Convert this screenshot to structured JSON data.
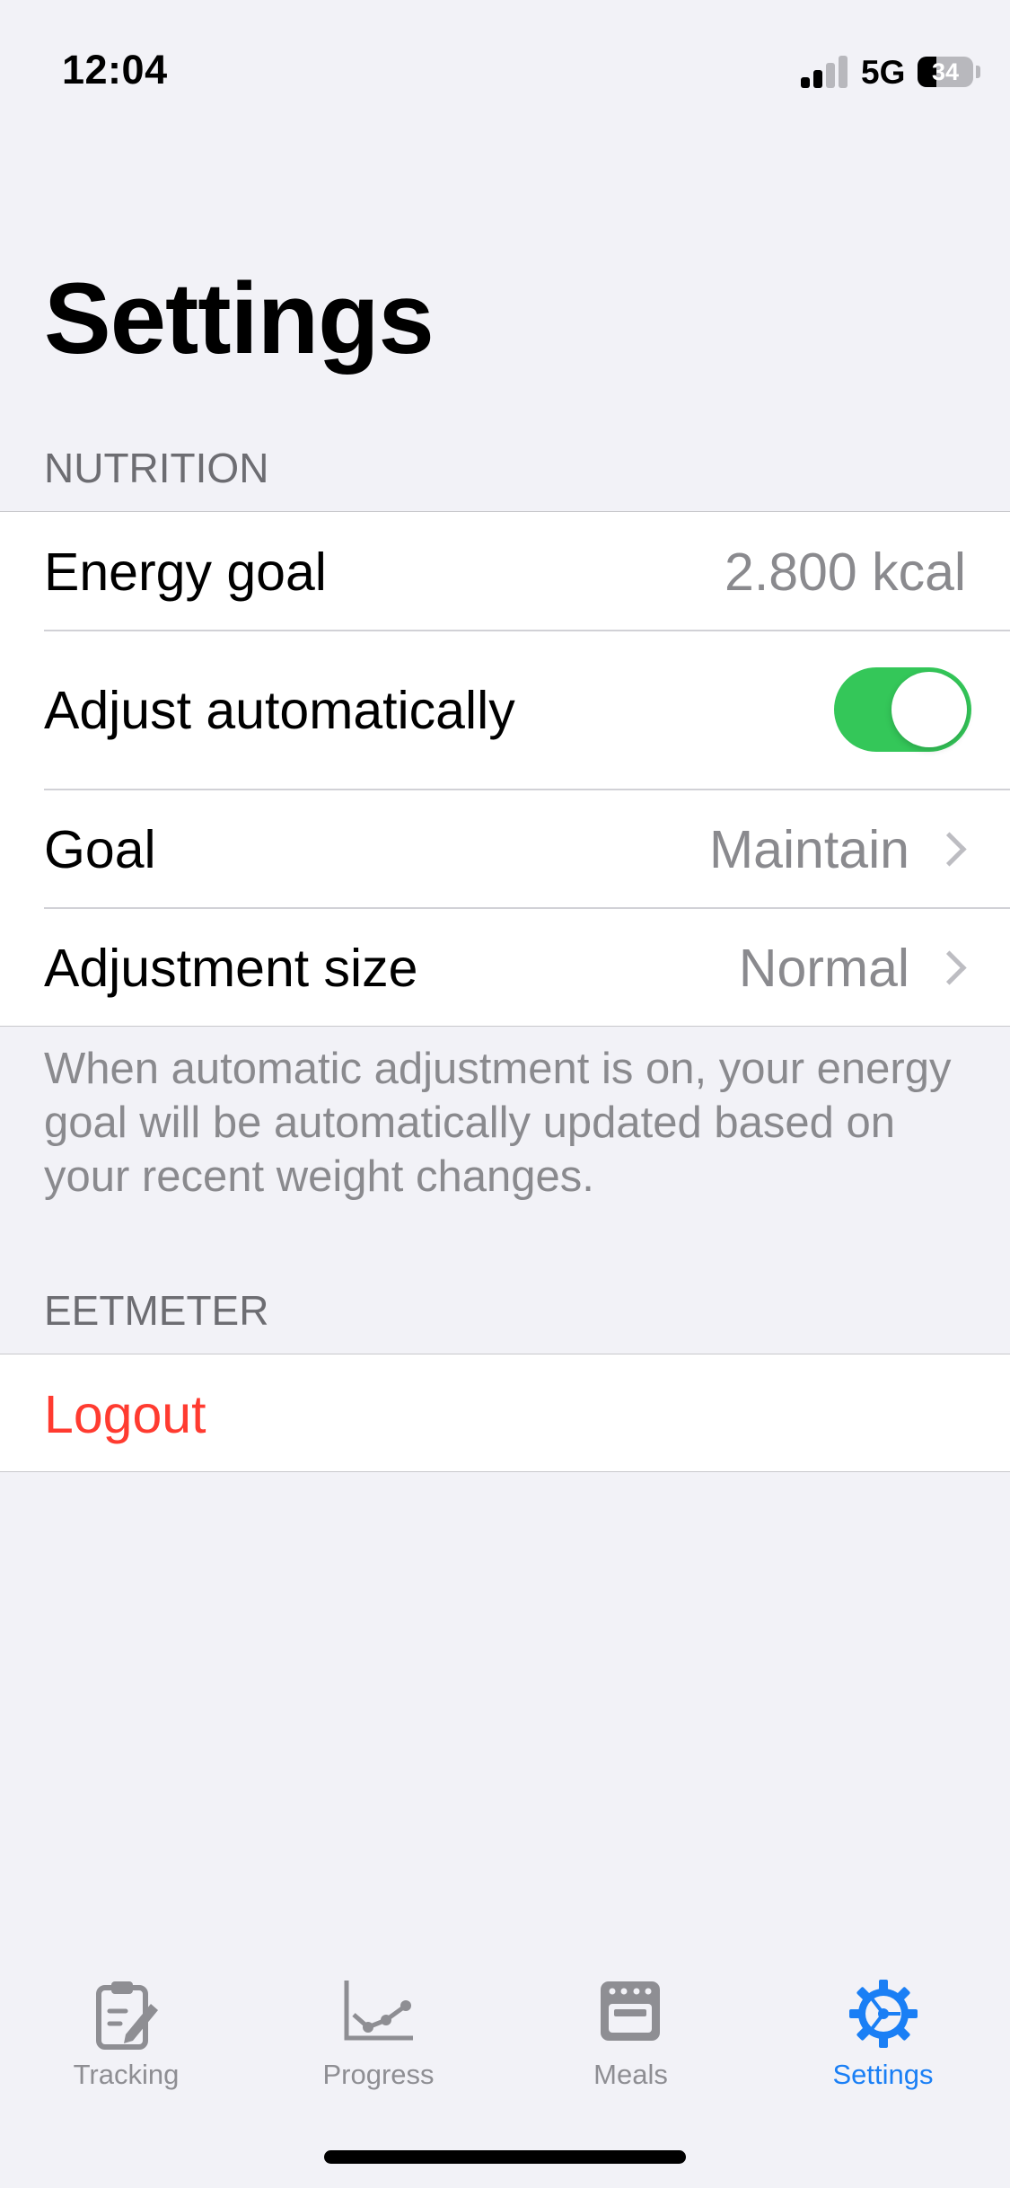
{
  "status_bar": {
    "time": "12:04",
    "network": "5G",
    "battery": "34",
    "battery_level": 0.34
  },
  "page": {
    "title": "Settings"
  },
  "nutrition": {
    "header": "NUTRITION",
    "energy_goal": {
      "label": "Energy goal",
      "value": "2.800 kcal"
    },
    "adjust_automatically": {
      "label": "Adjust automatically",
      "enabled": true
    },
    "goal": {
      "label": "Goal",
      "value": "Maintain"
    },
    "adjustment_size": {
      "label": "Adjustment size",
      "value": "Normal"
    },
    "footer": "When automatic adjustment is on, your energy goal will be automatically updated based on your recent weight changes."
  },
  "eetmeter": {
    "header": "EETMETER",
    "logout": "Logout"
  },
  "tabs": [
    {
      "label": "Tracking",
      "icon": "clipboard-edit-icon",
      "active": false
    },
    {
      "label": "Progress",
      "icon": "line-chart-icon",
      "active": false
    },
    {
      "label": "Meals",
      "icon": "oven-icon",
      "active": false
    },
    {
      "label": "Settings",
      "icon": "gear-icon",
      "active": true
    }
  ],
  "colors": {
    "background": "#f2f2f7",
    "toggle_on": "#34c759",
    "destructive": "#ff3b30",
    "accent": "#1a7ff5",
    "secondary_text": "#8a8a8e"
  }
}
